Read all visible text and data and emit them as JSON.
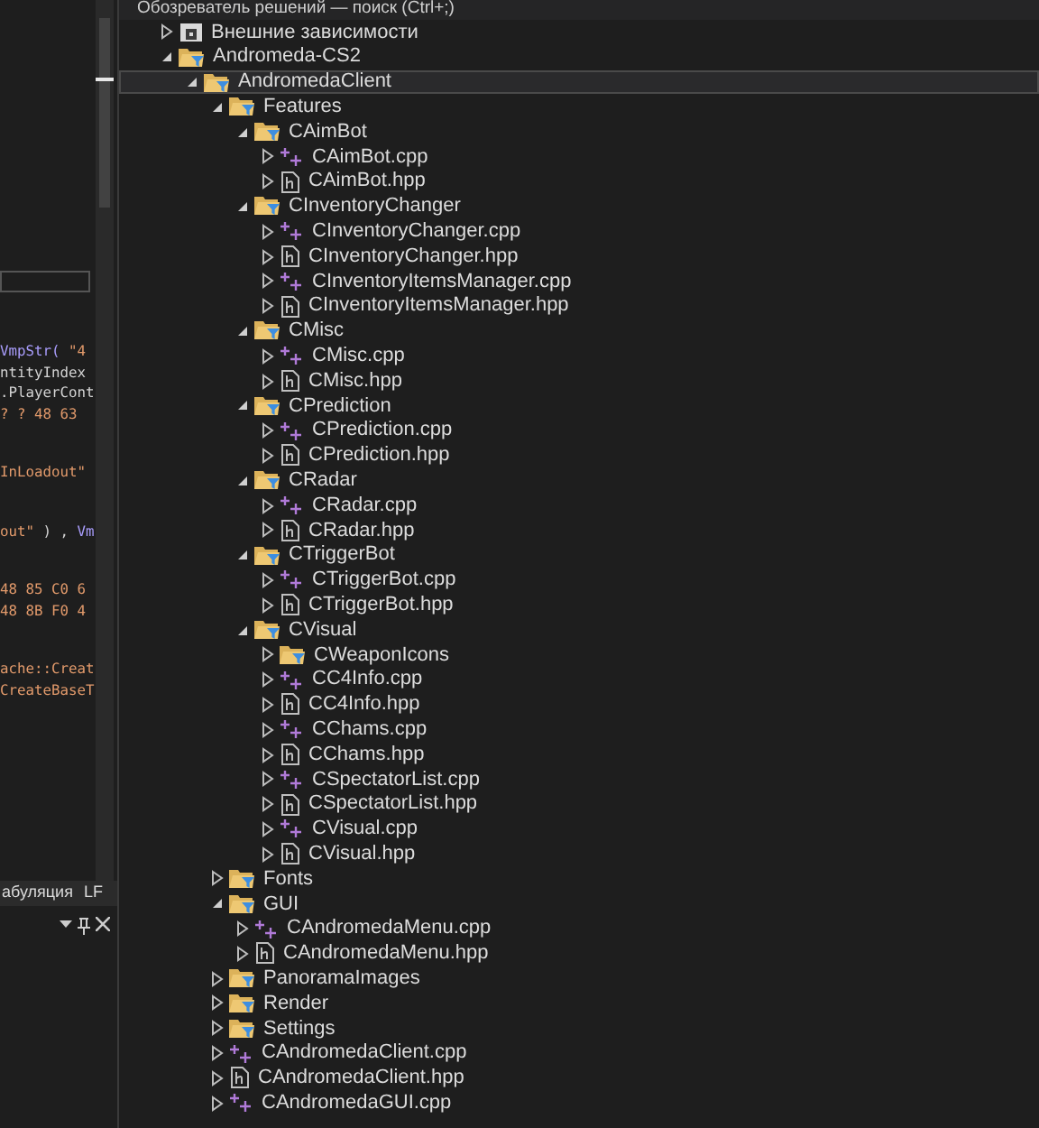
{
  "editor": {
    "code_groups": [
      [
        [
          {
            "text": "VmpStr( ",
            "kind": "func"
          },
          {
            "text": "\"4",
            "kind": "string"
          }
        ],
        [
          {
            "text": "ntityIndex",
            "kind": "ident"
          }
        ],
        [
          {
            "text": ".PlayerCont",
            "kind": "ident"
          }
        ],
        [
          {
            "text": "? ? 48 63",
            "kind": "number"
          }
        ]
      ],
      [
        [
          {
            "text": "InLoadout\"",
            "kind": "string"
          }
        ]
      ],
      [
        [
          {
            "text": "out\"",
            "kind": "string"
          },
          {
            "text": " ) , ",
            "kind": "ident"
          },
          {
            "text": "Vm",
            "kind": "func"
          }
        ]
      ],
      [
        [
          {
            "text": "48 85 C0 6",
            "kind": "number"
          }
        ],
        [
          {
            "text": "48 8B F0 4",
            "kind": "number"
          }
        ]
      ],
      [
        [
          {
            "text": "ache::Creat",
            "kind": "string"
          }
        ],
        [
          {
            "text": "CreateBaseT",
            "kind": "string"
          }
        ]
      ]
    ],
    "status_bar": [
      "абуляция",
      "LF"
    ]
  },
  "solution_explorer": {
    "title": "Обозреватель решений — поиск (Ctrl+;)",
    "tree": [
      {
        "label": "Внешние зависимости",
        "kind": "external",
        "expanded": false,
        "selected": false
      },
      {
        "label": "Andromeda-CS2",
        "kind": "folder",
        "expanded": true,
        "selected": false,
        "children": [
          {
            "label": "AndromedaClient",
            "kind": "folder",
            "expanded": true,
            "selected": true,
            "children": [
              {
                "label": "Features",
                "kind": "folder",
                "expanded": true,
                "selected": false,
                "children": [
                  {
                    "label": "CAimBot",
                    "kind": "folder",
                    "expanded": true,
                    "selected": false,
                    "children": [
                      {
                        "label": "CAimBot.cpp",
                        "kind": "cpp",
                        "expanded": false,
                        "selected": false
                      },
                      {
                        "label": "CAimBot.hpp",
                        "kind": "hpp",
                        "expanded": false,
                        "selected": false
                      }
                    ]
                  },
                  {
                    "label": "CInventoryChanger",
                    "kind": "folder",
                    "expanded": true,
                    "selected": false,
                    "children": [
                      {
                        "label": "CInventoryChanger.cpp",
                        "kind": "cpp",
                        "expanded": false,
                        "selected": false
                      },
                      {
                        "label": "CInventoryChanger.hpp",
                        "kind": "hpp",
                        "expanded": false,
                        "selected": false
                      },
                      {
                        "label": "CInventoryItemsManager.cpp",
                        "kind": "cpp",
                        "expanded": false,
                        "selected": false
                      },
                      {
                        "label": "CInventoryItemsManager.hpp",
                        "kind": "hpp",
                        "expanded": false,
                        "selected": false
                      }
                    ]
                  },
                  {
                    "label": "CMisc",
                    "kind": "folder",
                    "expanded": true,
                    "selected": false,
                    "children": [
                      {
                        "label": "CMisc.cpp",
                        "kind": "cpp",
                        "expanded": false,
                        "selected": false
                      },
                      {
                        "label": "CMisc.hpp",
                        "kind": "hpp",
                        "expanded": false,
                        "selected": false
                      }
                    ]
                  },
                  {
                    "label": "CPrediction",
                    "kind": "folder",
                    "expanded": true,
                    "selected": false,
                    "children": [
                      {
                        "label": "CPrediction.cpp",
                        "kind": "cpp",
                        "expanded": false,
                        "selected": false
                      },
                      {
                        "label": "CPrediction.hpp",
                        "kind": "hpp",
                        "expanded": false,
                        "selected": false
                      }
                    ]
                  },
                  {
                    "label": "CRadar",
                    "kind": "folder",
                    "expanded": true,
                    "selected": false,
                    "children": [
                      {
                        "label": "CRadar.cpp",
                        "kind": "cpp",
                        "expanded": false,
                        "selected": false
                      },
                      {
                        "label": "CRadar.hpp",
                        "kind": "hpp",
                        "expanded": false,
                        "selected": false
                      }
                    ]
                  },
                  {
                    "label": "CTriggerBot",
                    "kind": "folder",
                    "expanded": true,
                    "selected": false,
                    "children": [
                      {
                        "label": "CTriggerBot.cpp",
                        "kind": "cpp",
                        "expanded": false,
                        "selected": false
                      },
                      {
                        "label": "CTriggerBot.hpp",
                        "kind": "hpp",
                        "expanded": false,
                        "selected": false
                      }
                    ]
                  },
                  {
                    "label": "CVisual",
                    "kind": "folder",
                    "expanded": true,
                    "selected": false,
                    "children": [
                      {
                        "label": "CWeaponIcons",
                        "kind": "folder",
                        "expanded": false,
                        "selected": false
                      },
                      {
                        "label": "CC4Info.cpp",
                        "kind": "cpp",
                        "expanded": false,
                        "selected": false
                      },
                      {
                        "label": "CC4Info.hpp",
                        "kind": "hpp",
                        "expanded": false,
                        "selected": false
                      },
                      {
                        "label": "CChams.cpp",
                        "kind": "cpp",
                        "expanded": false,
                        "selected": false
                      },
                      {
                        "label": "CChams.hpp",
                        "kind": "hpp",
                        "expanded": false,
                        "selected": false
                      },
                      {
                        "label": "CSpectatorList.cpp",
                        "kind": "cpp",
                        "expanded": false,
                        "selected": false
                      },
                      {
                        "label": "CSpectatorList.hpp",
                        "kind": "hpp",
                        "expanded": false,
                        "selected": false
                      },
                      {
                        "label": "CVisual.cpp",
                        "kind": "cpp",
                        "expanded": false,
                        "selected": false
                      },
                      {
                        "label": "CVisual.hpp",
                        "kind": "hpp",
                        "expanded": false,
                        "selected": false
                      }
                    ]
                  }
                ]
              },
              {
                "label": "Fonts",
                "kind": "folder",
                "expanded": false,
                "selected": false
              },
              {
                "label": "GUI",
                "kind": "folder",
                "expanded": true,
                "selected": false,
                "children": [
                  {
                    "label": "CAndromedaMenu.cpp",
                    "kind": "cpp",
                    "expanded": false,
                    "selected": false
                  },
                  {
                    "label": "CAndromedaMenu.hpp",
                    "kind": "hpp",
                    "expanded": false,
                    "selected": false
                  }
                ]
              },
              {
                "label": "PanoramaImages",
                "kind": "folder",
                "expanded": false,
                "selected": false
              },
              {
                "label": "Render",
                "kind": "folder",
                "expanded": false,
                "selected": false
              },
              {
                "label": "Settings",
                "kind": "folder",
                "expanded": false,
                "selected": false
              },
              {
                "label": "CAndromedaClient.cpp",
                "kind": "cpp",
                "expanded": false,
                "selected": false
              },
              {
                "label": "CAndromedaClient.hpp",
                "kind": "hpp",
                "expanded": false,
                "selected": false
              },
              {
                "label": "CAndromedaGUI.cpp",
                "kind": "cpp",
                "expanded": false,
                "selected": false
              }
            ]
          }
        ]
      }
    ]
  }
}
